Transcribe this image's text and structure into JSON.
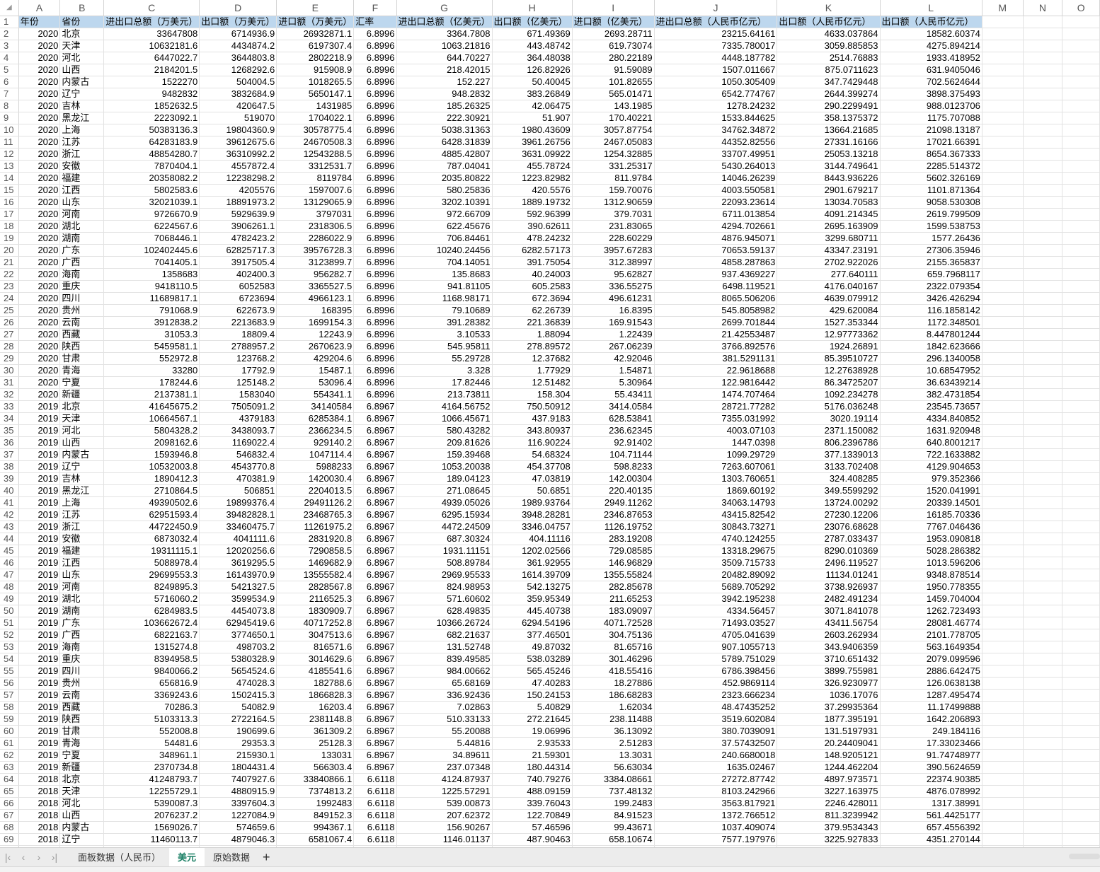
{
  "columns": [
    "A",
    "B",
    "C",
    "D",
    "E",
    "F",
    "G",
    "H",
    "I",
    "J",
    "K",
    "L",
    "M",
    "N",
    "O"
  ],
  "headers": [
    "年份",
    "省份",
    "进出口总额（万美元）",
    "出口额（万美元）",
    "进口额（万美元）",
    "汇率",
    "进出口总额（亿美元）",
    "出口额（亿美元）",
    "进口额（亿美元）",
    "进出口总额（人民币亿元）",
    "出口额（人民币亿元）",
    "出口额（人民币亿元）"
  ],
  "header_fill": "#bdd7ee",
  "rows": [
    [
      "2020",
      "北京",
      "33647808",
      "6714936.9",
      "26932871.1",
      "6.8996",
      "3364.7808",
      "671.49369",
      "2693.28711",
      "23215.64161",
      "4633.037864",
      "18582.60374"
    ],
    [
      "2020",
      "天津",
      "10632181.6",
      "4434874.2",
      "6197307.4",
      "6.8996",
      "1063.21816",
      "443.48742",
      "619.73074",
      "7335.780017",
      "3059.885853",
      "4275.894214"
    ],
    [
      "2020",
      "河北",
      "6447022.7",
      "3644803.8",
      "2802218.9",
      "6.8996",
      "644.70227",
      "364.48038",
      "280.22189",
      "4448.187782",
      "2514.76883",
      "1933.418952"
    ],
    [
      "2020",
      "山西",
      "2184201.5",
      "1268292.6",
      "915908.9",
      "6.8996",
      "218.42015",
      "126.82926",
      "91.59089",
      "1507.011667",
      "875.0711623",
      "631.9405046"
    ],
    [
      "2020",
      "内蒙古",
      "1522270",
      "504004.5",
      "1018265.5",
      "6.8996",
      "152.227",
      "50.40045",
      "101.82655",
      "1050.305409",
      "347.7429448",
      "702.5624644"
    ],
    [
      "2020",
      "辽宁",
      "9482832",
      "3832684.9",
      "5650147.1",
      "6.8996",
      "948.2832",
      "383.26849",
      "565.01471",
      "6542.774767",
      "2644.399274",
      "3898.375493"
    ],
    [
      "2020",
      "吉林",
      "1852632.5",
      "420647.5",
      "1431985",
      "6.8996",
      "185.26325",
      "42.06475",
      "143.1985",
      "1278.24232",
      "290.2299491",
      "988.0123706"
    ],
    [
      "2020",
      "黑龙江",
      "2223092.1",
      "519070",
      "1704022.1",
      "6.8996",
      "222.30921",
      "51.907",
      "170.40221",
      "1533.844625",
      "358.1375372",
      "1175.707088"
    ],
    [
      "2020",
      "上海",
      "50383136.3",
      "19804360.9",
      "30578775.4",
      "6.8996",
      "5038.31363",
      "1980.43609",
      "3057.87754",
      "34762.34872",
      "13664.21685",
      "21098.13187"
    ],
    [
      "2020",
      "江苏",
      "64283183.9",
      "39612675.6",
      "24670508.3",
      "6.8996",
      "6428.31839",
      "3961.26756",
      "2467.05083",
      "44352.82556",
      "27331.16166",
      "17021.66391"
    ],
    [
      "2020",
      "浙江",
      "48854280.7",
      "36310992.2",
      "12543288.5",
      "6.8996",
      "4885.42807",
      "3631.09922",
      "1254.32885",
      "33707.49951",
      "25053.13218",
      "8654.367333"
    ],
    [
      "2020",
      "安徽",
      "7870404.1",
      "4557872.4",
      "3312531.7",
      "6.8996",
      "787.04041",
      "455.78724",
      "331.25317",
      "5430.264013",
      "3144.749641",
      "2285.514372"
    ],
    [
      "2020",
      "福建",
      "20358082.2",
      "12238298.2",
      "8119784",
      "6.8996",
      "2035.80822",
      "1223.82982",
      "811.9784",
      "14046.26239",
      "8443.936226",
      "5602.326169"
    ],
    [
      "2020",
      "江西",
      "5802583.6",
      "4205576",
      "1597007.6",
      "6.8996",
      "580.25836",
      "420.5576",
      "159.70076",
      "4003.550581",
      "2901.679217",
      "1101.871364"
    ],
    [
      "2020",
      "山东",
      "32021039.1",
      "18891973.2",
      "13129065.9",
      "6.8996",
      "3202.10391",
      "1889.19732",
      "1312.90659",
      "22093.23614",
      "13034.70583",
      "9058.530308"
    ],
    [
      "2020",
      "河南",
      "9726670.9",
      "5929639.9",
      "3797031",
      "6.8996",
      "972.66709",
      "592.96399",
      "379.7031",
      "6711.013854",
      "4091.214345",
      "2619.799509"
    ],
    [
      "2020",
      "湖北",
      "6224567.6",
      "3906261.1",
      "2318306.5",
      "6.8996",
      "622.45676",
      "390.62611",
      "231.83065",
      "4294.702661",
      "2695.163909",
      "1599.538753"
    ],
    [
      "2020",
      "湖南",
      "7068446.1",
      "4782423.2",
      "2286022.9",
      "6.8996",
      "706.84461",
      "478.24232",
      "228.60229",
      "4876.945071",
      "3299.680711",
      "1577.26436"
    ],
    [
      "2020",
      "广东",
      "102402445.6",
      "62825717.3",
      "39576728.3",
      "6.8996",
      "10240.24456",
      "6282.57173",
      "3957.67283",
      "70653.59137",
      "43347.23191",
      "27306.35946"
    ],
    [
      "2020",
      "广西",
      "7041405.1",
      "3917505.4",
      "3123899.7",
      "6.8996",
      "704.14051",
      "391.75054",
      "312.38997",
      "4858.287863",
      "2702.922026",
      "2155.365837"
    ],
    [
      "2020",
      "海南",
      "1358683",
      "402400.3",
      "956282.7",
      "6.8996",
      "135.8683",
      "40.24003",
      "95.62827",
      "937.4369227",
      "277.640111",
      "659.7968117"
    ],
    [
      "2020",
      "重庆",
      "9418110.5",
      "6052583",
      "3365527.5",
      "6.8996",
      "941.81105",
      "605.2583",
      "336.55275",
      "6498.119521",
      "4176.040167",
      "2322.079354"
    ],
    [
      "2020",
      "四川",
      "11689817.1",
      "6723694",
      "4966123.1",
      "6.8996",
      "1168.98171",
      "672.3694",
      "496.61231",
      "8065.506206",
      "4639.079912",
      "3426.426294"
    ],
    [
      "2020",
      "贵州",
      "791068.9",
      "622673.9",
      "168395",
      "6.8996",
      "79.10689",
      "62.26739",
      "16.8395",
      "545.8058982",
      "429.620084",
      "116.1858142"
    ],
    [
      "2020",
      "云南",
      "3912838.2",
      "2213683.9",
      "1699154.3",
      "6.8996",
      "391.28382",
      "221.36839",
      "169.91543",
      "2699.701844",
      "1527.353344",
      "1172.348501"
    ],
    [
      "2020",
      "西藏",
      "31053.3",
      "18809.4",
      "12243.9",
      "6.8996",
      "3.10533",
      "1.88094",
      "1.22439",
      "21.42553487",
      "12.97773362",
      "8.447801244"
    ],
    [
      "2020",
      "陕西",
      "5459581.1",
      "2788957.2",
      "2670623.9",
      "6.8996",
      "545.95811",
      "278.89572",
      "267.06239",
      "3766.892576",
      "1924.26891",
      "1842.623666"
    ],
    [
      "2020",
      "甘肃",
      "552972.8",
      "123768.2",
      "429204.6",
      "6.8996",
      "55.29728",
      "12.37682",
      "42.92046",
      "381.5291131",
      "85.39510727",
      "296.1340058"
    ],
    [
      "2020",
      "青海",
      "33280",
      "17792.9",
      "15487.1",
      "6.8996",
      "3.328",
      "1.77929",
      "1.54871",
      "22.9618688",
      "12.27638928",
      "10.68547952"
    ],
    [
      "2020",
      "宁夏",
      "178244.6",
      "125148.2",
      "53096.4",
      "6.8996",
      "17.82446",
      "12.51482",
      "5.30964",
      "122.9816442",
      "86.34725207",
      "36.63439214"
    ],
    [
      "2020",
      "新疆",
      "2137381.1",
      "1583040",
      "554341.1",
      "6.8996",
      "213.73811",
      "158.304",
      "55.43411",
      "1474.707464",
      "1092.234278",
      "382.4731854"
    ],
    [
      "2019",
      "北京",
      "41645675.2",
      "7505091.2",
      "34140584",
      "6.8967",
      "4164.56752",
      "750.50912",
      "3414.0584",
      "28721.77282",
      "5176.036248",
      "23545.73657"
    ],
    [
      "2019",
      "天津",
      "10664567.1",
      "4379183",
      "6285384.1",
      "6.8967",
      "1066.45671",
      "437.9183",
      "628.53841",
      "7355.031992",
      "3020.19114",
      "4334.840852"
    ],
    [
      "2019",
      "河北",
      "5804328.2",
      "3438093.7",
      "2366234.5",
      "6.8967",
      "580.43282",
      "343.80937",
      "236.62345",
      "4003.07103",
      "2371.150082",
      "1631.920948"
    ],
    [
      "2019",
      "山西",
      "2098162.6",
      "1169022.4",
      "929140.2",
      "6.8967",
      "209.81626",
      "116.90224",
      "92.91402",
      "1447.0398",
      "806.2396786",
      "640.8001217"
    ],
    [
      "2019",
      "内蒙古",
      "1593946.8",
      "546832.4",
      "1047114.4",
      "6.8967",
      "159.39468",
      "54.68324",
      "104.71144",
      "1099.29729",
      "377.1339013",
      "722.1633882"
    ],
    [
      "2019",
      "辽宁",
      "10532003.8",
      "4543770.8",
      "5988233",
      "6.8967",
      "1053.20038",
      "454.37708",
      "598.8233",
      "7263.607061",
      "3133.702408",
      "4129.904653"
    ],
    [
      "2019",
      "吉林",
      "1890412.3",
      "470381.9",
      "1420030.4",
      "6.8967",
      "189.04123",
      "47.03819",
      "142.00304",
      "1303.760651",
      "324.408285",
      "979.352366"
    ],
    [
      "2019",
      "黑龙江",
      "2710864.5",
      "506851",
      "2204013.5",
      "6.8967",
      "271.08645",
      "50.6851",
      "220.40135",
      "1869.60192",
      "349.5599292",
      "1520.041991"
    ],
    [
      "2019",
      "上海",
      "49390502.6",
      "19899376.4",
      "29491126.2",
      "6.8967",
      "4939.05026",
      "1989.93764",
      "2949.11262",
      "34063.14793",
      "13724.00292",
      "20339.14501"
    ],
    [
      "2019",
      "江苏",
      "62951593.4",
      "39482828.1",
      "23468765.3",
      "6.8967",
      "6295.15934",
      "3948.28281",
      "2346.87653",
      "43415.82542",
      "27230.12206",
      "16185.70336"
    ],
    [
      "2019",
      "浙江",
      "44722450.9",
      "33460475.7",
      "11261975.2",
      "6.8967",
      "4472.24509",
      "3346.04757",
      "1126.19752",
      "30843.73271",
      "23076.68628",
      "7767.046436"
    ],
    [
      "2019",
      "安徽",
      "6873032.4",
      "4041111.6",
      "2831920.8",
      "6.8967",
      "687.30324",
      "404.11116",
      "283.19208",
      "4740.124255",
      "2787.033437",
      "1953.090818"
    ],
    [
      "2019",
      "福建",
      "19311115.1",
      "12020256.6",
      "7290858.5",
      "6.8967",
      "1931.11151",
      "1202.02566",
      "729.08585",
      "13318.29675",
      "8290.010369",
      "5028.286382"
    ],
    [
      "2019",
      "江西",
      "5088978.4",
      "3619295.5",
      "1469682.9",
      "6.8967",
      "508.89784",
      "361.92955",
      "146.96829",
      "3509.715733",
      "2496.119527",
      "1013.596206"
    ],
    [
      "2019",
      "山东",
      "29699553.3",
      "16143970.9",
      "13555582.4",
      "6.8967",
      "2969.95533",
      "1614.39709",
      "1355.55824",
      "20482.89092",
      "11134.01241",
      "9348.878514"
    ],
    [
      "2019",
      "河南",
      "8249895.3",
      "5421327.5",
      "2828567.8",
      "6.8967",
      "824.98953",
      "542.13275",
      "282.85678",
      "5689.705292",
      "3738.926937",
      "1950.778355"
    ],
    [
      "2019",
      "湖北",
      "5716060.2",
      "3599534.9",
      "2116525.3",
      "6.8967",
      "571.60602",
      "359.95349",
      "211.65253",
      "3942.195238",
      "2482.491234",
      "1459.704004"
    ],
    [
      "2019",
      "湖南",
      "6284983.5",
      "4454073.8",
      "1830909.7",
      "6.8967",
      "628.49835",
      "445.40738",
      "183.09097",
      "4334.56457",
      "3071.841078",
      "1262.723493"
    ],
    [
      "2019",
      "广东",
      "103662672.4",
      "62945419.6",
      "40717252.8",
      "6.8967",
      "10366.26724",
      "6294.54196",
      "4071.72528",
      "71493.03527",
      "43411.56754",
      "28081.46774"
    ],
    [
      "2019",
      "广西",
      "6822163.7",
      "3774650.1",
      "3047513.6",
      "6.8967",
      "682.21637",
      "377.46501",
      "304.75136",
      "4705.041639",
      "2603.262934",
      "2101.778705"
    ],
    [
      "2019",
      "海南",
      "1315274.8",
      "498703.2",
      "816571.6",
      "6.8967",
      "131.52748",
      "49.87032",
      "81.65716",
      "907.1055713",
      "343.9406359",
      "563.1649354"
    ],
    [
      "2019",
      "重庆",
      "8394958.5",
      "5380328.9",
      "3014629.6",
      "6.8967",
      "839.49585",
      "538.03289",
      "301.46296",
      "5789.751029",
      "3710.651432",
      "2079.099596"
    ],
    [
      "2019",
      "四川",
      "9840066.2",
      "5654524.6",
      "4185541.6",
      "6.8967",
      "984.00662",
      "565.45246",
      "418.55416",
      "6786.398456",
      "3899.755981",
      "2886.642475"
    ],
    [
      "2019",
      "贵州",
      "656816.9",
      "474028.3",
      "182788.6",
      "6.8967",
      "65.68169",
      "47.40283",
      "18.27886",
      "452.9869114",
      "326.9230977",
      "126.0638138"
    ],
    [
      "2019",
      "云南",
      "3369243.6",
      "1502415.3",
      "1866828.3",
      "6.8967",
      "336.92436",
      "150.24153",
      "186.68283",
      "2323.666234",
      "1036.17076",
      "1287.495474"
    ],
    [
      "2019",
      "西藏",
      "70286.3",
      "54082.9",
      "16203.4",
      "6.8967",
      "7.02863",
      "5.40829",
      "1.62034",
      "48.47435252",
      "37.29935364",
      "11.17499888"
    ],
    [
      "2019",
      "陕西",
      "5103313.3",
      "2722164.5",
      "2381148.8",
      "6.8967",
      "510.33133",
      "272.21645",
      "238.11488",
      "3519.602084",
      "1877.395191",
      "1642.206893"
    ],
    [
      "2019",
      "甘肃",
      "552008.8",
      "190699.6",
      "361309.2",
      "6.8967",
      "55.20088",
      "19.06996",
      "36.13092",
      "380.7039091",
      "131.5197931",
      "249.184116"
    ],
    [
      "2019",
      "青海",
      "54481.6",
      "29353.3",
      "25128.3",
      "6.8967",
      "5.44816",
      "2.93533",
      "2.51283",
      "37.57432507",
      "20.24409041",
      "17.33023466"
    ],
    [
      "2019",
      "宁夏",
      "348961.1",
      "215930.1",
      "133031",
      "6.8967",
      "34.89611",
      "21.59301",
      "13.3031",
      "240.6680018",
      "148.9205121",
      "91.74748977"
    ],
    [
      "2019",
      "新疆",
      "2370734.8",
      "1804431.4",
      "566303.4",
      "6.8967",
      "237.07348",
      "180.44314",
      "56.63034",
      "1635.02467",
      "1244.462204",
      "390.5624659"
    ],
    [
      "2018",
      "北京",
      "41248793.7",
      "7407927.6",
      "33840866.1",
      "6.6118",
      "4124.87937",
      "740.79276",
      "3384.08661",
      "27272.87742",
      "4897.973571",
      "22374.90385"
    ],
    [
      "2018",
      "天津",
      "12255729.1",
      "4880915.9",
      "7374813.2",
      "6.6118",
      "1225.57291",
      "488.09159",
      "737.48132",
      "8103.242966",
      "3227.163975",
      "4876.078992"
    ],
    [
      "2018",
      "河北",
      "5390087.3",
      "3397604.3",
      "1992483",
      "6.6118",
      "539.00873",
      "339.76043",
      "199.2483",
      "3563.817921",
      "2246.428011",
      "1317.38991"
    ],
    [
      "2018",
      "山西",
      "2076237.2",
      "1227084.9",
      "849152.3",
      "6.6118",
      "207.62372",
      "122.70849",
      "84.91523",
      "1372.766512",
      "811.3239942",
      "561.4425177"
    ],
    [
      "2018",
      "内蒙古",
      "1569026.7",
      "574659.6",
      "994367.1",
      "6.6118",
      "156.90267",
      "57.46596",
      "99.43671",
      "1037.409074",
      "379.9534343",
      "657.4556392"
    ],
    [
      "2018",
      "辽宁",
      "11460113.7",
      "4879046.3",
      "6581067.4",
      "6.6118",
      "1146.01137",
      "487.90463",
      "658.10674",
      "7577.197976",
      "3225.927833",
      "4351.270144"
    ]
  ],
  "sheet_tabs": [
    {
      "label": "面板数据（人民币）",
      "active": false
    },
    {
      "label": "美元",
      "active": true
    },
    {
      "label": "原始数据",
      "active": false
    }
  ],
  "add_sheet": "+",
  "nav_icons": [
    "first-sheet-icon",
    "prev-sheet-icon",
    "next-sheet-icon",
    "last-sheet-icon"
  ]
}
